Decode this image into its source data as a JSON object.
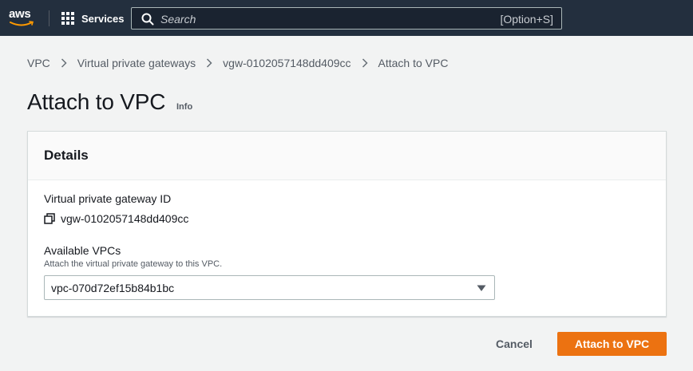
{
  "topnav": {
    "logo_text": "aws",
    "services_label": "Services",
    "search": {
      "placeholder": "Search",
      "shortcut": "[Option+S]"
    }
  },
  "breadcrumb": {
    "items": [
      "VPC",
      "Virtual private gateways",
      "vgw-0102057148dd409cc",
      "Attach to VPC"
    ]
  },
  "page": {
    "title": "Attach to VPC",
    "info_link": "Info"
  },
  "details": {
    "heading": "Details",
    "gateway_id_label": "Virtual private gateway ID",
    "gateway_id_value": "vgw-0102057148dd409cc",
    "vpcs_label": "Available VPCs",
    "vpcs_description": "Attach the virtual private gateway to this VPC.",
    "vpcs_selected": "vpc-070d72ef15b84b1bc"
  },
  "actions": {
    "cancel_label": "Cancel",
    "submit_label": "Attach to VPC"
  },
  "colors": {
    "nav_background": "#232f3e",
    "primary_button": "#ec7211",
    "page_background": "#f2f3f3"
  }
}
